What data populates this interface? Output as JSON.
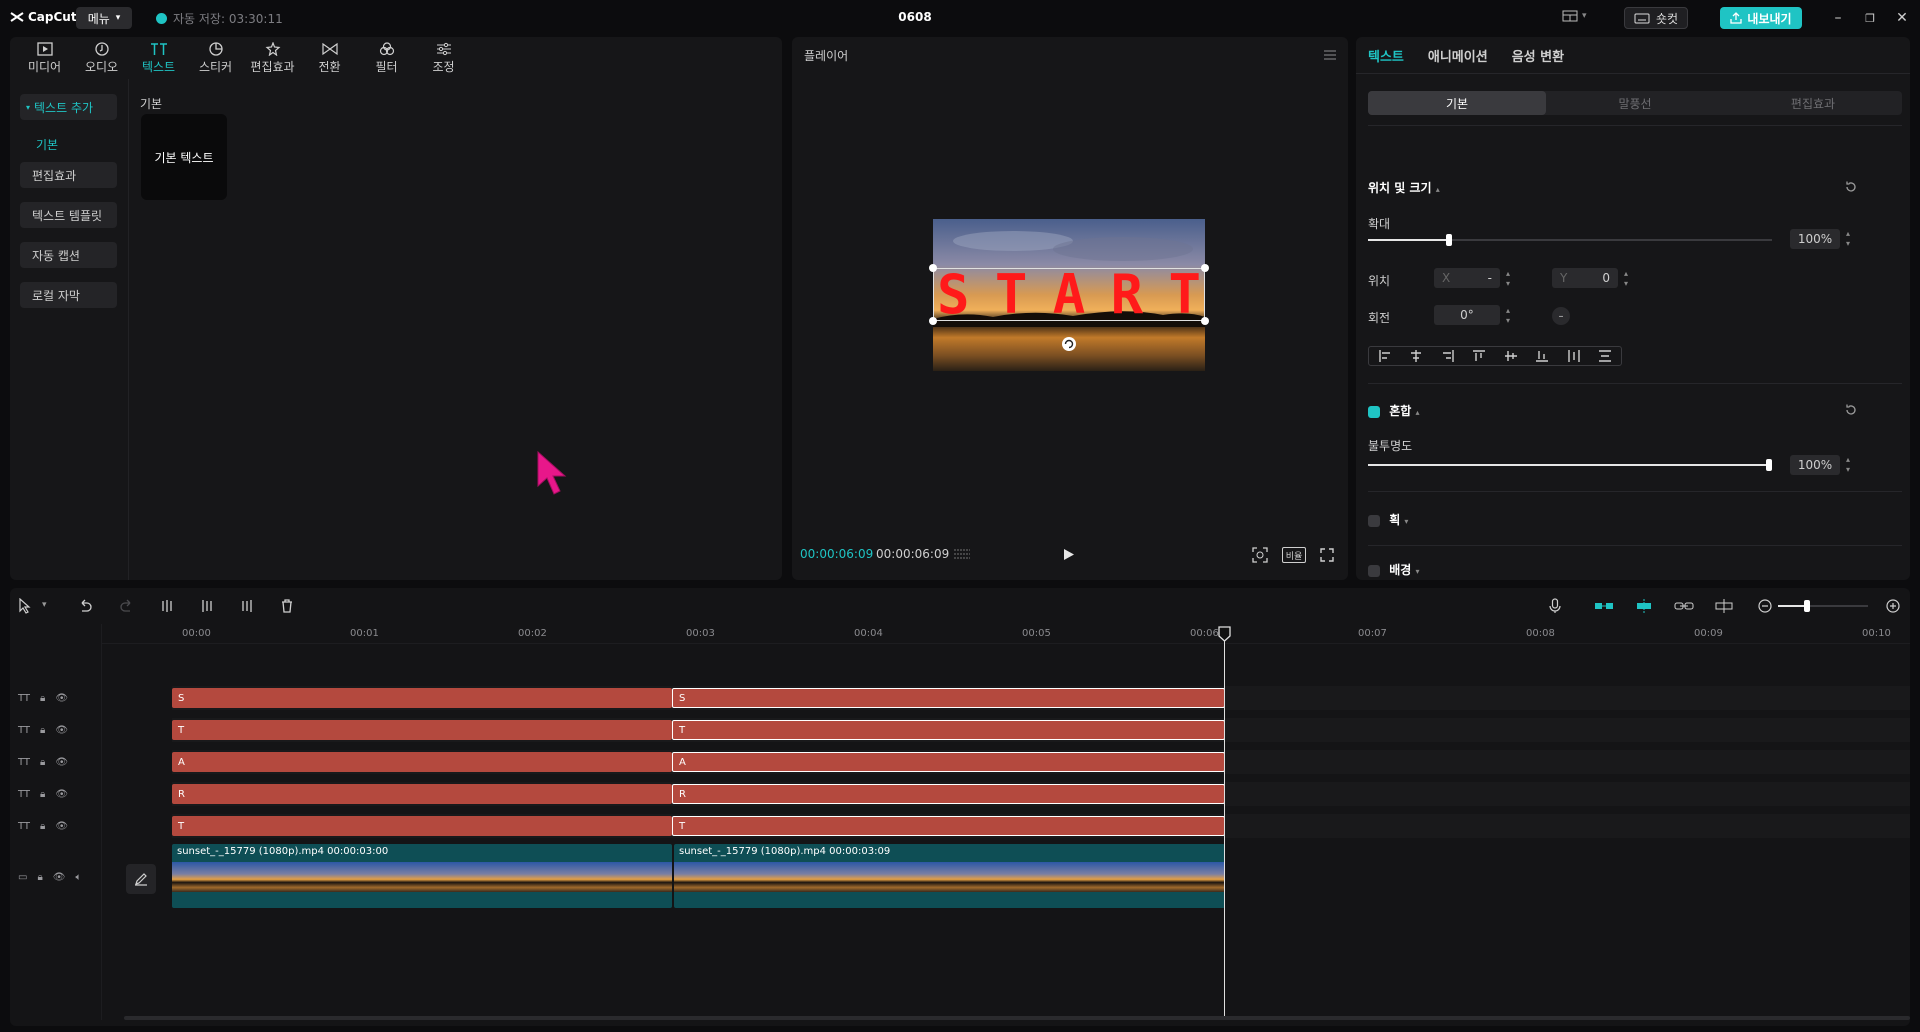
{
  "app": {
    "logo": "CapCut",
    "menu_label": "메뉴",
    "autosave": "자동 저장: 03:30:11",
    "project_title": "0608",
    "shortcut_label": "숏컷",
    "export_label": "내보내기"
  },
  "media_tabs": [
    {
      "label": "미디어",
      "icon": "media-icon"
    },
    {
      "label": "오디오",
      "icon": "audio-icon"
    },
    {
      "label": "텍스트",
      "icon": "text-icon"
    },
    {
      "label": "스티커",
      "icon": "sticker-icon"
    },
    {
      "label": "편집효과",
      "icon": "effects-icon"
    },
    {
      "label": "전환",
      "icon": "transition-icon"
    },
    {
      "label": "필터",
      "icon": "filter-icon"
    },
    {
      "label": "조정",
      "icon": "adjust-icon"
    }
  ],
  "text_sidebar": {
    "add_text": "텍스트 추가",
    "basic": "기본",
    "effects": "편집효과",
    "templates": "텍스트 템플릿",
    "auto_captions": "자동 캡션",
    "local_captions": "로컬 자막"
  },
  "text_library": {
    "section": "기본",
    "card_label": "기본 텍스트"
  },
  "player": {
    "title": "플레이어",
    "overlay_text": [
      "S",
      "T",
      "A",
      "R",
      "T"
    ],
    "current_time": "00:00:06:09",
    "total_time": "00:00:06:09",
    "ratio_label": "비율"
  },
  "props": {
    "tabs": [
      "텍스트",
      "애니메이션",
      "음성 변환"
    ],
    "subtabs": [
      "기본",
      "말풍선",
      "편집효과"
    ],
    "position_size": "위치 및 크기",
    "scale_label": "확대",
    "scale_value": "100%",
    "scale_fraction": 0.2,
    "position_label": "위치",
    "pos_x_label": "X",
    "pos_x": "-",
    "pos_y_label": "Y",
    "pos_y": "0",
    "rotate_label": "회전",
    "rotate_value": "0°",
    "blend_label": "혼합",
    "opacity_label": "불투명도",
    "opacity_value": "100%",
    "opacity_fraction": 1.0,
    "stroke_label": "획",
    "background_label": "배경"
  },
  "timeline": {
    "ticks": [
      "00:00",
      "00:01",
      "00:02",
      "00:03",
      "00:04",
      "00:05",
      "00:06",
      "00:07",
      "00:08",
      "00:09",
      "00:10"
    ],
    "text_tracks": [
      {
        "left": "S",
        "right": "S"
      },
      {
        "left": "T",
        "right": "T"
      },
      {
        "left": "A",
        "right": "A"
      },
      {
        "left": "R",
        "right": "R"
      },
      {
        "left": "T",
        "right": "T"
      }
    ],
    "video_clips": [
      {
        "label": "sunset_-_15779 (1080p).mp4   00:00:03:00"
      },
      {
        "label": "sunset_-_15779 (1080p).mp4   00:00:03:09"
      }
    ]
  },
  "colors": {
    "accent": "#1fc4c4",
    "text_clip": "#b4493e",
    "video_clip": "#0e4e55",
    "overlay_text": "#ff1a1a"
  }
}
